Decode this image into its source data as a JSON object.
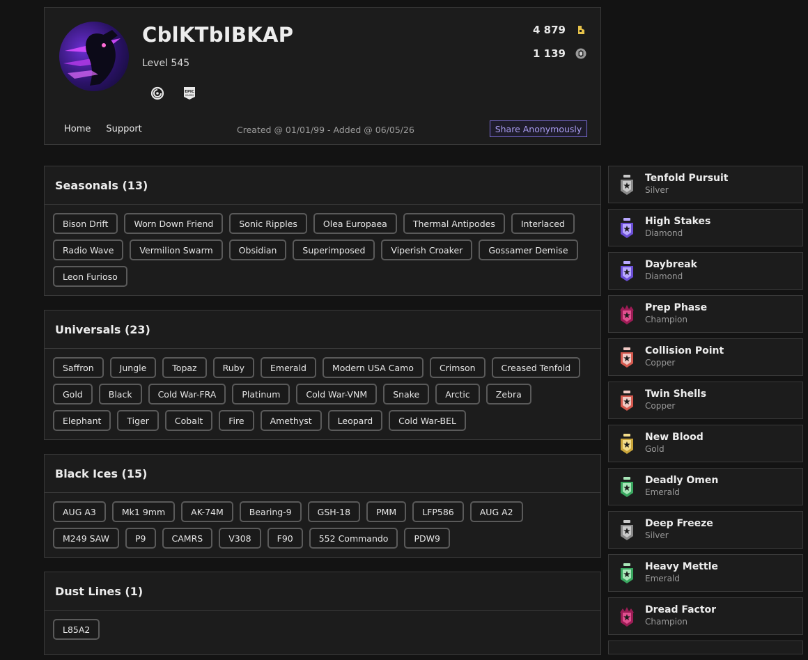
{
  "profile": {
    "username": "CblKTbIBKAP",
    "level": "Level 545",
    "platforms": [
      "ubisoft-icon",
      "epic-games-icon"
    ],
    "renown": "4 879",
    "credits": "1 139",
    "nav": {
      "home": "Home",
      "support": "Support"
    },
    "created": "Created @ 01/01/99 - Added @ 06/05/26",
    "share_label": "Share Anonymously"
  },
  "sections": [
    {
      "title": "Seasonals (13)",
      "items": [
        "Bison Drift",
        "Worn Down Friend",
        "Sonic Ripples",
        "Olea Europaea",
        "Thermal Antipodes",
        "Interlaced",
        "Radio Wave",
        "Vermilion Swarm",
        "Obsidian",
        "Superimposed",
        "Viperish Croaker",
        "Gossamer Demise",
        "Leon Furioso"
      ]
    },
    {
      "title": "Universals (23)",
      "items": [
        "Saffron",
        "Jungle",
        "Topaz",
        "Ruby",
        "Emerald",
        "Modern USA Camo",
        "Crimson",
        "Creased Tenfold",
        "Gold",
        "Black",
        "Cold War-FRA",
        "Platinum",
        "Cold War-VNM",
        "Snake",
        "Arctic",
        "Zebra",
        "Elephant",
        "Tiger",
        "Cobalt",
        "Fire",
        "Amethyst",
        "Leopard",
        "Cold War-BEL"
      ]
    },
    {
      "title": "Black Ices (15)",
      "items": [
        "AUG A3",
        "Mk1 9mm",
        "AK-74M",
        "Bearing-9",
        "GSH-18",
        "PMM",
        "LFP586",
        "AUG A2",
        "M249 SAW",
        "P9",
        "CAMRS",
        "V308",
        "F90",
        "552 Commando",
        "PDW9"
      ]
    },
    {
      "title": "Dust Lines (1)",
      "items": [
        "L85A2"
      ]
    }
  ],
  "achievements": [
    {
      "title": "Tenfold Pursuit",
      "tier": "Silver",
      "color": "#c9c9c9",
      "accent": "#8a8a8a"
    },
    {
      "title": "High Stakes",
      "tier": "Diamond",
      "color": "#b9a8ff",
      "accent": "#6b4fd6"
    },
    {
      "title": "Daybreak",
      "tier": "Diamond",
      "color": "#b9a8ff",
      "accent": "#6b4fd6"
    },
    {
      "title": "Prep Phase",
      "tier": "Champion",
      "color": "#e0508f",
      "accent": "#9c1c55"
    },
    {
      "title": "Collision Point",
      "tier": "Copper",
      "color": "#f0c9c4",
      "accent": "#d55a4f"
    },
    {
      "title": "Twin Shells",
      "tier": "Copper",
      "color": "#f0c9c4",
      "accent": "#d55a4f"
    },
    {
      "title": "New Blood",
      "tier": "Gold",
      "color": "#f3dc8a",
      "accent": "#c9a53b"
    },
    {
      "title": "Deadly Omen",
      "tier": "Emerald",
      "color": "#a8e6b8",
      "accent": "#3aa760"
    },
    {
      "title": "Deep Freeze",
      "tier": "Silver",
      "color": "#c9c9c9",
      "accent": "#8a8a8a"
    },
    {
      "title": "Heavy Mettle",
      "tier": "Emerald",
      "color": "#a8e6b8",
      "accent": "#3aa760"
    },
    {
      "title": "Dread Factor",
      "tier": "Champion",
      "color": "#e0508f",
      "accent": "#9c1c55"
    }
  ]
}
